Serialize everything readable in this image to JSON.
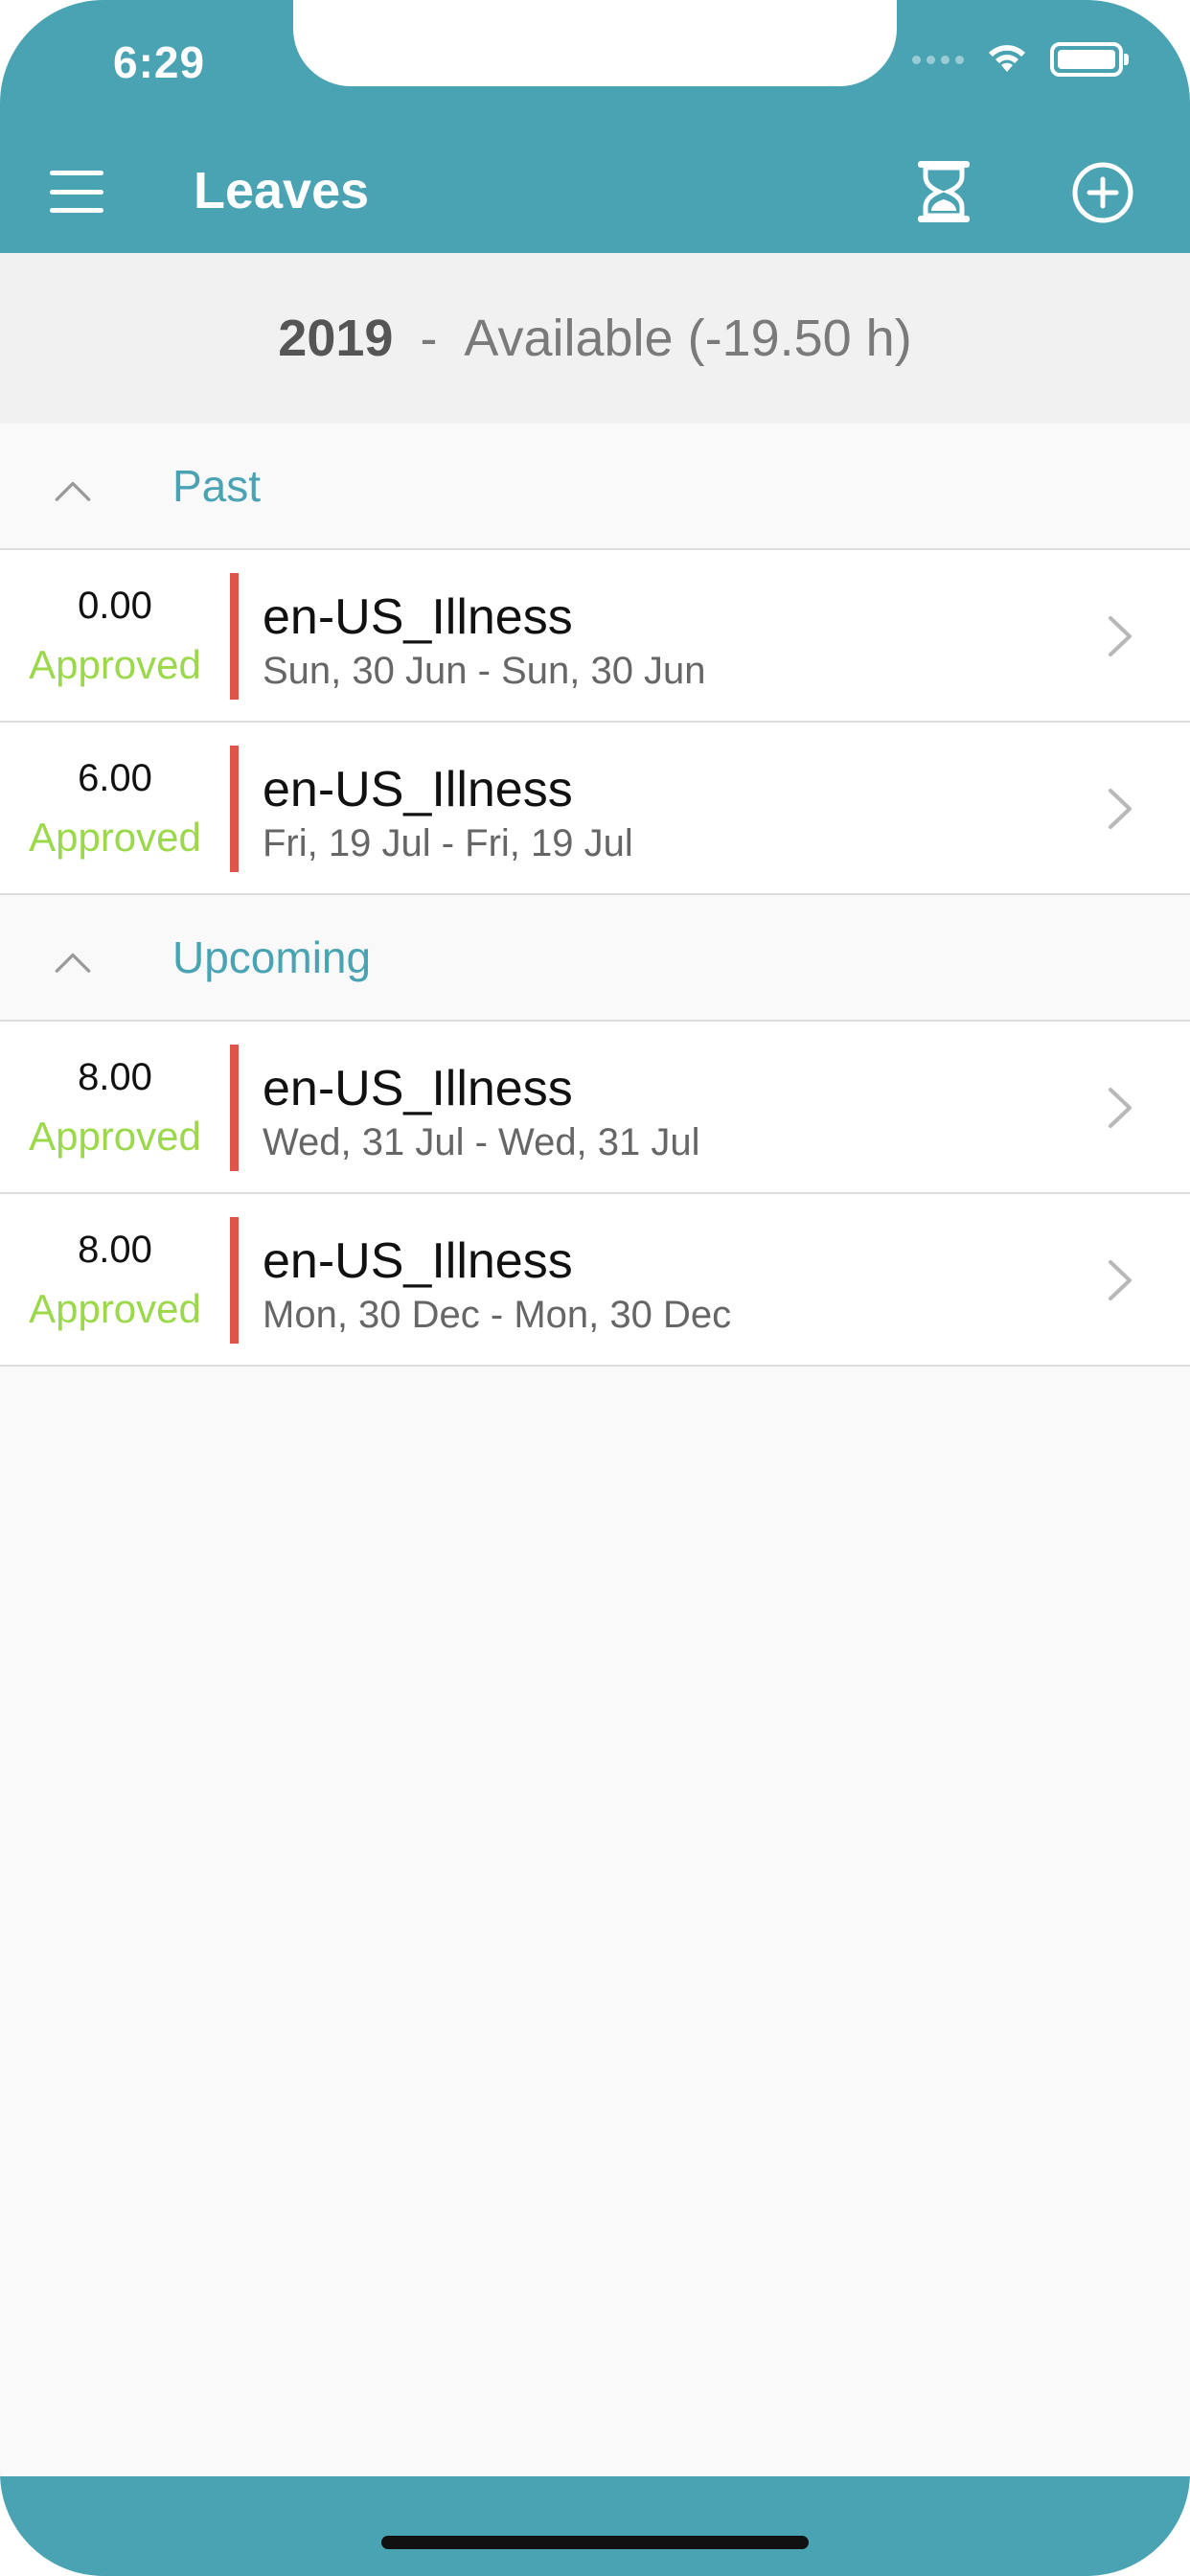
{
  "status_bar": {
    "time": "6:29"
  },
  "navbar": {
    "title": "Leaves"
  },
  "summary": {
    "year": "2019",
    "separator": "-",
    "available": "Available (-19.50 h)"
  },
  "sections": [
    {
      "title": "Past",
      "items": [
        {
          "hours": "0.00",
          "status": "Approved",
          "type": "en-US_Illness",
          "dates": "Sun, 30 Jun - Sun, 30 Jun"
        },
        {
          "hours": "6.00",
          "status": "Approved",
          "type": "en-US_Illness",
          "dates": "Fri, 19 Jul - Fri, 19 Jul"
        }
      ]
    },
    {
      "title": "Upcoming",
      "items": [
        {
          "hours": "8.00",
          "status": "Approved",
          "type": "en-US_Illness",
          "dates": "Wed, 31 Jul - Wed, 31 Jul"
        },
        {
          "hours": "8.00",
          "status": "Approved",
          "type": "en-US_Illness",
          "dates": "Mon, 30 Dec - Mon, 30 Dec"
        }
      ]
    }
  ],
  "colors": {
    "brand": "#4aa3b3",
    "approved": "#9bd84a",
    "leave_bar": "#de5547"
  },
  "icons": {
    "menu": "menu-icon",
    "timer": "hourglass-icon",
    "add": "plus-circle-icon",
    "collapse": "chevron-up-icon",
    "disclosure": "chevron-right-icon"
  }
}
